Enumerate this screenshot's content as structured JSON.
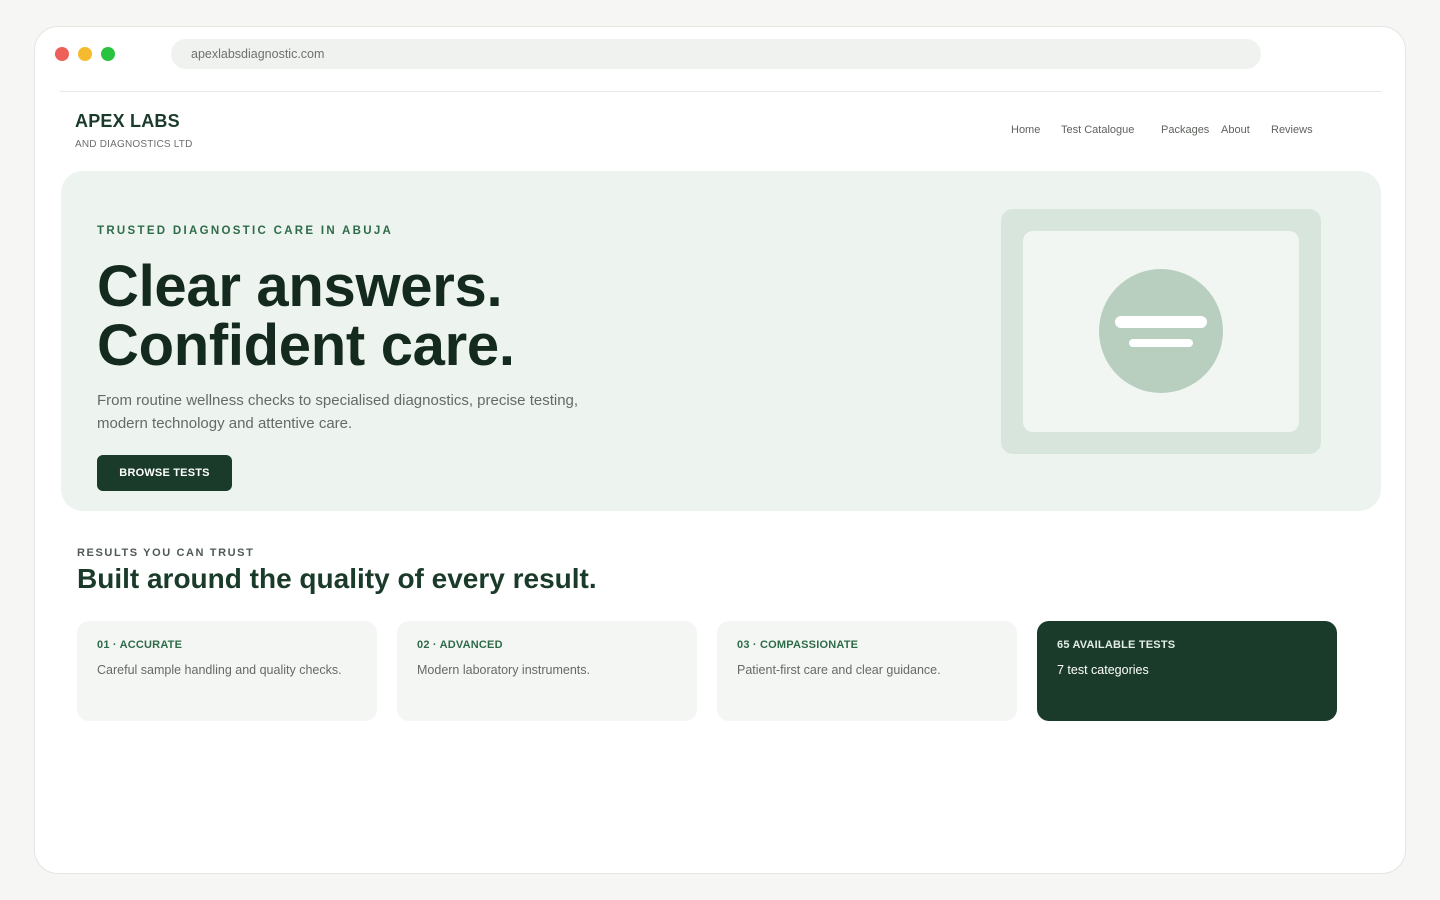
{
  "browser": {
    "url": "apexlabsdiagnostic.com"
  },
  "brand": {
    "name": "APEX LABS",
    "subtitle": "AND DIAGNOSTICS LTD"
  },
  "nav": {
    "items": [
      "Home",
      "Test Catalogue",
      "Packages",
      "About",
      "Reviews"
    ]
  },
  "hero": {
    "eyebrow": "TRUSTED DIAGNOSTIC CARE IN ABUJA",
    "title_line1": "Clear answers.",
    "title_line2": "Confident care.",
    "text": "From routine wellness checks to specialised diagnostics, precise testing, modern technology and attentive care.",
    "cta_label": "BROWSE TESTS",
    "illustration_icon": "document-icon"
  },
  "quality": {
    "eyebrow": "RESULTS YOU CAN TRUST",
    "title": "Built around the quality of every result.",
    "cards": [
      {
        "label": "01 · ACCURATE",
        "text": "Careful sample handling and quality checks."
      },
      {
        "label": "02 · ADVANCED",
        "text": "Modern laboratory instruments."
      },
      {
        "label": "03 · COMPASSIONATE",
        "text": "Patient-first care and clear guidance."
      },
      {
        "label": "65 AVAILABLE TESTS",
        "text": "7 test categories"
      }
    ]
  },
  "colors": {
    "brand_dark": "#1b3b2a",
    "accent_green": "#2e6b48",
    "hero_bg": "#edf3ee",
    "card_bg": "#f4f6f4"
  }
}
